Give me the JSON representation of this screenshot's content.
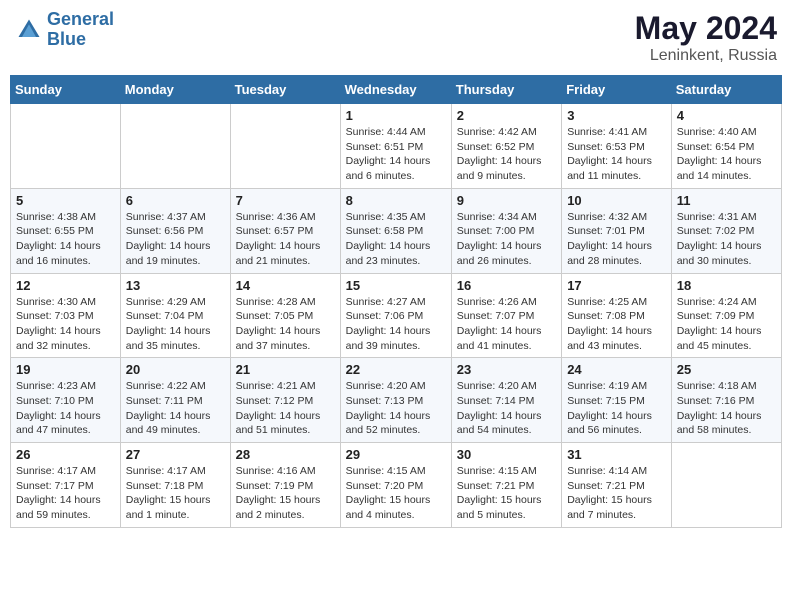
{
  "logo": {
    "line1": "General",
    "line2": "Blue"
  },
  "title": "May 2024",
  "subtitle": "Leninkent, Russia",
  "days_of_week": [
    "Sunday",
    "Monday",
    "Tuesday",
    "Wednesday",
    "Thursday",
    "Friday",
    "Saturday"
  ],
  "weeks": [
    [
      {
        "day": "",
        "info": ""
      },
      {
        "day": "",
        "info": ""
      },
      {
        "day": "",
        "info": ""
      },
      {
        "day": "1",
        "info": "Sunrise: 4:44 AM\nSunset: 6:51 PM\nDaylight: 14 hours\nand 6 minutes."
      },
      {
        "day": "2",
        "info": "Sunrise: 4:42 AM\nSunset: 6:52 PM\nDaylight: 14 hours\nand 9 minutes."
      },
      {
        "day": "3",
        "info": "Sunrise: 4:41 AM\nSunset: 6:53 PM\nDaylight: 14 hours\nand 11 minutes."
      },
      {
        "day": "4",
        "info": "Sunrise: 4:40 AM\nSunset: 6:54 PM\nDaylight: 14 hours\nand 14 minutes."
      }
    ],
    [
      {
        "day": "5",
        "info": "Sunrise: 4:38 AM\nSunset: 6:55 PM\nDaylight: 14 hours\nand 16 minutes."
      },
      {
        "day": "6",
        "info": "Sunrise: 4:37 AM\nSunset: 6:56 PM\nDaylight: 14 hours\nand 19 minutes."
      },
      {
        "day": "7",
        "info": "Sunrise: 4:36 AM\nSunset: 6:57 PM\nDaylight: 14 hours\nand 21 minutes."
      },
      {
        "day": "8",
        "info": "Sunrise: 4:35 AM\nSunset: 6:58 PM\nDaylight: 14 hours\nand 23 minutes."
      },
      {
        "day": "9",
        "info": "Sunrise: 4:34 AM\nSunset: 7:00 PM\nDaylight: 14 hours\nand 26 minutes."
      },
      {
        "day": "10",
        "info": "Sunrise: 4:32 AM\nSunset: 7:01 PM\nDaylight: 14 hours\nand 28 minutes."
      },
      {
        "day": "11",
        "info": "Sunrise: 4:31 AM\nSunset: 7:02 PM\nDaylight: 14 hours\nand 30 minutes."
      }
    ],
    [
      {
        "day": "12",
        "info": "Sunrise: 4:30 AM\nSunset: 7:03 PM\nDaylight: 14 hours\nand 32 minutes."
      },
      {
        "day": "13",
        "info": "Sunrise: 4:29 AM\nSunset: 7:04 PM\nDaylight: 14 hours\nand 35 minutes."
      },
      {
        "day": "14",
        "info": "Sunrise: 4:28 AM\nSunset: 7:05 PM\nDaylight: 14 hours\nand 37 minutes."
      },
      {
        "day": "15",
        "info": "Sunrise: 4:27 AM\nSunset: 7:06 PM\nDaylight: 14 hours\nand 39 minutes."
      },
      {
        "day": "16",
        "info": "Sunrise: 4:26 AM\nSunset: 7:07 PM\nDaylight: 14 hours\nand 41 minutes."
      },
      {
        "day": "17",
        "info": "Sunrise: 4:25 AM\nSunset: 7:08 PM\nDaylight: 14 hours\nand 43 minutes."
      },
      {
        "day": "18",
        "info": "Sunrise: 4:24 AM\nSunset: 7:09 PM\nDaylight: 14 hours\nand 45 minutes."
      }
    ],
    [
      {
        "day": "19",
        "info": "Sunrise: 4:23 AM\nSunset: 7:10 PM\nDaylight: 14 hours\nand 47 minutes."
      },
      {
        "day": "20",
        "info": "Sunrise: 4:22 AM\nSunset: 7:11 PM\nDaylight: 14 hours\nand 49 minutes."
      },
      {
        "day": "21",
        "info": "Sunrise: 4:21 AM\nSunset: 7:12 PM\nDaylight: 14 hours\nand 51 minutes."
      },
      {
        "day": "22",
        "info": "Sunrise: 4:20 AM\nSunset: 7:13 PM\nDaylight: 14 hours\nand 52 minutes."
      },
      {
        "day": "23",
        "info": "Sunrise: 4:20 AM\nSunset: 7:14 PM\nDaylight: 14 hours\nand 54 minutes."
      },
      {
        "day": "24",
        "info": "Sunrise: 4:19 AM\nSunset: 7:15 PM\nDaylight: 14 hours\nand 56 minutes."
      },
      {
        "day": "25",
        "info": "Sunrise: 4:18 AM\nSunset: 7:16 PM\nDaylight: 14 hours\nand 58 minutes."
      }
    ],
    [
      {
        "day": "26",
        "info": "Sunrise: 4:17 AM\nSunset: 7:17 PM\nDaylight: 14 hours\nand 59 minutes."
      },
      {
        "day": "27",
        "info": "Sunrise: 4:17 AM\nSunset: 7:18 PM\nDaylight: 15 hours\nand 1 minute."
      },
      {
        "day": "28",
        "info": "Sunrise: 4:16 AM\nSunset: 7:19 PM\nDaylight: 15 hours\nand 2 minutes."
      },
      {
        "day": "29",
        "info": "Sunrise: 4:15 AM\nSunset: 7:20 PM\nDaylight: 15 hours\nand 4 minutes."
      },
      {
        "day": "30",
        "info": "Sunrise: 4:15 AM\nSunset: 7:21 PM\nDaylight: 15 hours\nand 5 minutes."
      },
      {
        "day": "31",
        "info": "Sunrise: 4:14 AM\nSunset: 7:21 PM\nDaylight: 15 hours\nand 7 minutes."
      },
      {
        "day": "",
        "info": ""
      }
    ]
  ]
}
